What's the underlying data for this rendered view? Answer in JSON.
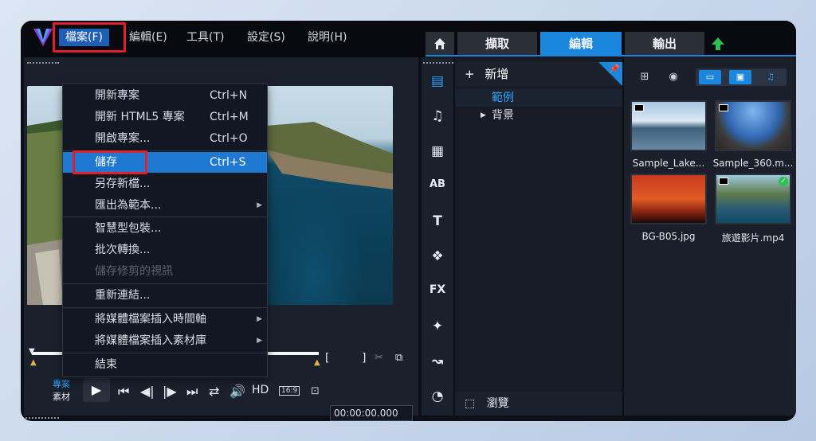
{
  "menu": {
    "items": [
      {
        "label": "檔案(F)"
      },
      {
        "label": "編輯(E)"
      },
      {
        "label": "工具(T)"
      },
      {
        "label": "設定(S)"
      },
      {
        "label": "說明(H)"
      }
    ]
  },
  "tabs": {
    "home_icon": "home-icon",
    "capture": "擷取",
    "edit": "編輯",
    "share": "輸出"
  },
  "file_menu": {
    "items": [
      {
        "label": "開新專案",
        "shortcut": "Ctrl+N"
      },
      {
        "label": "開新 HTML5 專案",
        "shortcut": "Ctrl+M"
      },
      {
        "label": "開啟專案...",
        "shortcut": "Ctrl+O"
      },
      {
        "label": "儲存",
        "shortcut": "Ctrl+S"
      },
      {
        "label": "另存新檔...",
        "shortcut": ""
      },
      {
        "label": "匯出為範本...",
        "shortcut": ""
      },
      {
        "label": "智慧型包裝...",
        "shortcut": ""
      },
      {
        "label": "批次轉換...",
        "shortcut": ""
      },
      {
        "label": "儲存修剪的視訊",
        "shortcut": ""
      },
      {
        "label": "重新連結...",
        "shortcut": ""
      },
      {
        "label": "將媒體檔案插入時間軸",
        "shortcut": ""
      },
      {
        "label": "將媒體檔案插入素材庫",
        "shortcut": ""
      },
      {
        "label": "結束",
        "shortcut": ""
      }
    ]
  },
  "player": {
    "project_label": "專案",
    "clip_label": "素材",
    "hd": "HD",
    "aspect": "16:9",
    "timecode": "00:00:00.000"
  },
  "library": {
    "add_label": "新增",
    "tree": [
      {
        "label": "範例"
      },
      {
        "label": "背景"
      }
    ],
    "browse_label": "瀏覽",
    "items": [
      {
        "name": "Sample_Lake..."
      },
      {
        "name": "Sample_360.m..."
      },
      {
        "name": "BG-B05.jpg"
      },
      {
        "name": "旅遊影片.mp4"
      }
    ]
  },
  "colors": {
    "accent": "#1a87dc",
    "highlight": "#e0202a",
    "selected_menu": "#1f78d1"
  }
}
